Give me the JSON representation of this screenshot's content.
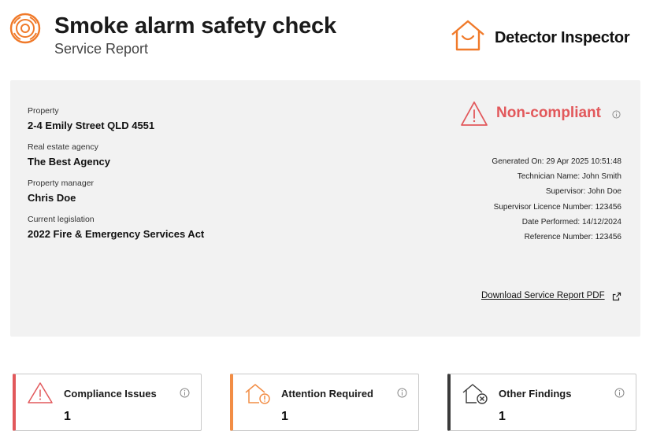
{
  "header": {
    "title": "Smoke alarm safety check",
    "subtitle": "Service Report",
    "brand_name": "Detector Inspector"
  },
  "property": {
    "property_label": "Property",
    "property_value": "2-4 Emily Street QLD 4551",
    "agency_label": "Real estate agency",
    "agency_value": "The Best Agency",
    "manager_label": "Property manager",
    "manager_value": "Chris Doe",
    "legislation_label": "Current legislation",
    "legislation_value": "2022 Fire & Emergency Services Act"
  },
  "status": {
    "label": "Non-compliant",
    "color": "#e2585b"
  },
  "meta": {
    "generated": "Generated On: 29 Apr 2025 10:51:48",
    "technician": "Technician Name: John Smith",
    "supervisor": "Supervisor: John Doe",
    "licence": "Supervisor Licence Number: 123456",
    "performed": "Date Performed: 14/12/2024",
    "reference": "Reference Number: 123456"
  },
  "download_link": "Download Service Report PDF",
  "summary": [
    {
      "title": "Compliance Issues",
      "count": "1",
      "color": "#e2585b",
      "icon": "warning-triangle-icon"
    },
    {
      "title": "Attention Required",
      "count": "1",
      "color": "#f28d45",
      "icon": "house-alert-icon"
    },
    {
      "title": "Other Findings",
      "count": "1",
      "color": "#3a3a3a",
      "icon": "house-x-icon"
    }
  ],
  "colors": {
    "accent": "#f07a2a",
    "card_bg": "#f2f2f2"
  }
}
